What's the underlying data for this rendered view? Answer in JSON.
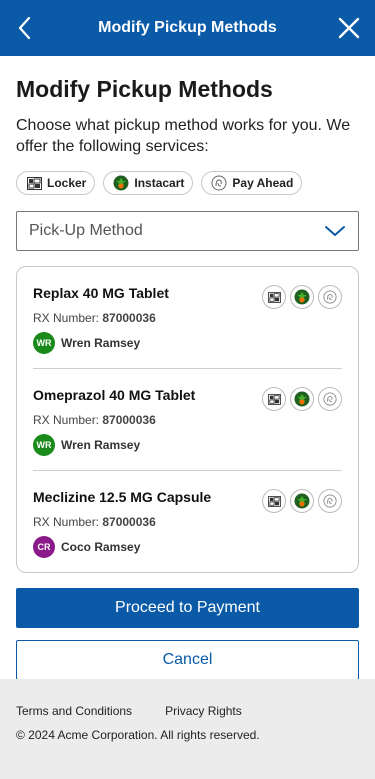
{
  "header": {
    "title": "Modify Pickup Methods"
  },
  "page": {
    "title": "Modify Pickup Methods",
    "intro": "Choose what pickup method works for you. We offer the following services:"
  },
  "services": [
    {
      "label": "Locker",
      "icon": "locker-icon"
    },
    {
      "label": "Instacart",
      "icon": "instacart-icon"
    },
    {
      "label": "Pay Ahead",
      "icon": "pay-ahead-icon"
    }
  ],
  "select": {
    "placeholder": "Pick-Up Method"
  },
  "prescriptions": [
    {
      "name": "Replax 40 MG Tablet",
      "rx_label": "RX Number: ",
      "rx_number": "87000036",
      "initials": "WR",
      "patient": "Wren Ramsey",
      "avatar_color": "#1a8a1a"
    },
    {
      "name": "Omeprazol 40 MG Tablet",
      "rx_label": "RX Number: ",
      "rx_number": "87000036",
      "initials": "WR",
      "patient": "Wren Ramsey",
      "avatar_color": "#1a8a1a"
    },
    {
      "name": "Meclizine 12.5 MG Capsule",
      "rx_label": "RX Number: ",
      "rx_number": "87000036",
      "initials": "CR",
      "patient": "Coco Ramsey",
      "avatar_color": "#8a1a8a"
    }
  ],
  "actions": {
    "proceed": "Proceed to Payment",
    "cancel": "Cancel"
  },
  "footer": {
    "terms": "Terms and Conditions",
    "privacy": "Privacy Rights",
    "copyright": "© 2024 Acme Corporation. All rights reserved."
  },
  "colors": {
    "brand": "#0a5aa8",
    "footer_bg": "#ececec"
  }
}
